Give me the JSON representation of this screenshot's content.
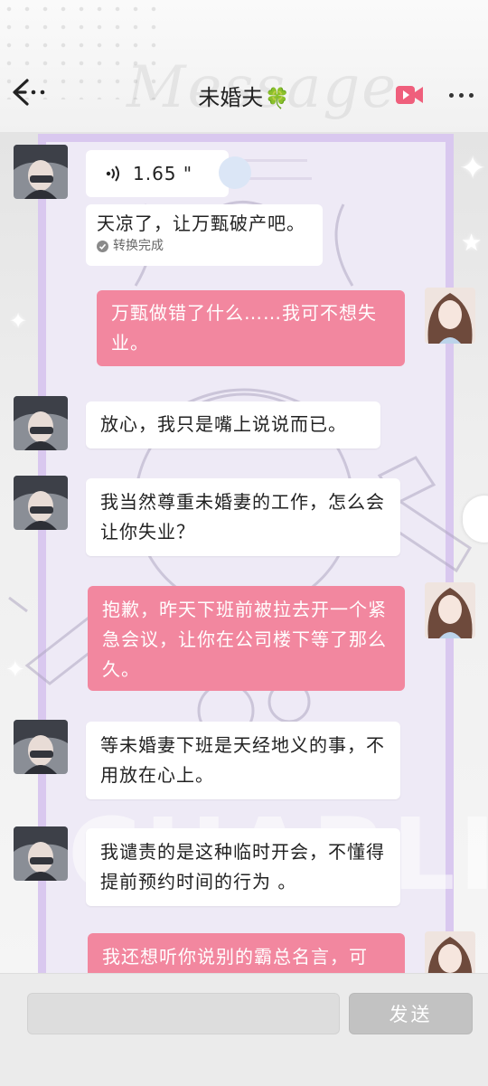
{
  "header": {
    "title": "未婚夫",
    "title_emoji": "🍀",
    "watermark": "Message"
  },
  "messages": [
    {
      "side": "left",
      "type": "voice",
      "duration": "1.65 \"",
      "transcript": "天凉了，让万甄破产吧。",
      "transcript_status": "转换完成"
    },
    {
      "side": "right",
      "type": "text",
      "text": "万甄做错了什么……我可不想失业。"
    },
    {
      "side": "left",
      "type": "text",
      "text": "放心，我只是嘴上说说而已。"
    },
    {
      "side": "left",
      "type": "text",
      "text": "我当然尊重未婚妻的工作，怎么会让你失业？"
    },
    {
      "side": "right",
      "type": "text",
      "text": "抱歉，昨天下班前被拉去开一个紧急会议，让你在公司楼下等了那么久。"
    },
    {
      "side": "left",
      "type": "text",
      "text": "等未婚妻下班是天经地义的事，不用放在心上。"
    },
    {
      "side": "left",
      "type": "text",
      "text": "我谴责的是这种临时开会，不懂得提前预约时间的行为 。"
    },
    {
      "side": "right",
      "type": "text",
      "text": "我还想听你说别的霸总名言，可"
    }
  ],
  "background_text": "CHARLIE",
  "input": {
    "value": "",
    "send_label": "发送"
  },
  "colors": {
    "outgoing_bubble": "#f2879f",
    "incoming_bubble": "#ffffff",
    "frame": "#d9c8ef",
    "send_button": "#c2c2c2",
    "video_icon": "#ef5f7c"
  },
  "icons": [
    "back-arrow-icon",
    "video-call-icon",
    "more-icon",
    "voice-wave-icon",
    "check-icon",
    "clover-icon"
  ]
}
